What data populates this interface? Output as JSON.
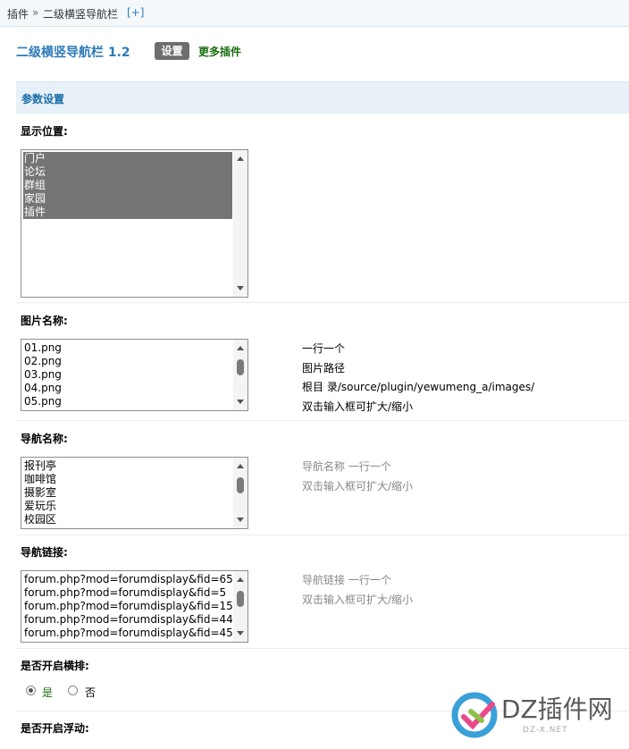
{
  "breadcrumb": {
    "root": "插件",
    "sep": "»",
    "current": "二级横竖导航栏",
    "add": "[+]"
  },
  "header": {
    "title": "二级横竖导航栏 1.2",
    "tab_settings": "设置",
    "tab_more": "更多插件"
  },
  "section_title": "参数设置",
  "display_position": {
    "label": "显示位置:",
    "options": [
      "门户",
      "论坛",
      "群组",
      "家园",
      "插件"
    ]
  },
  "image_names": {
    "label": "图片名称:",
    "lines": [
      "01.png",
      "02.png",
      "03.png",
      "04.png",
      "05.png"
    ],
    "hints": [
      "一行一个",
      "图片路径",
      "根目 录/source/plugin/yewumeng_a/images/",
      "双击输入框可扩大/缩小"
    ]
  },
  "nav_names": {
    "label": "导航名称:",
    "lines": [
      "报刊亭",
      "咖啡馆",
      "摄影室",
      "爱玩乐",
      "校园区"
    ],
    "hints": [
      "导航名称 一行一个",
      "双击输入框可扩大/缩小"
    ]
  },
  "nav_links": {
    "label": "导航链接:",
    "lines": [
      "forum.php?mod=forumdisplay&fid=65",
      "forum.php?mod=forumdisplay&fid=5",
      "forum.php?mod=forumdisplay&fid=15",
      "forum.php?mod=forumdisplay&fid=44",
      "forum.php?mod=forumdisplay&fid=45"
    ],
    "hints": [
      "导航链接 一行一个",
      "双击输入框可扩大/缩小"
    ]
  },
  "horizontal": {
    "label": "是否开启横排:",
    "yes": "是",
    "no": "否",
    "selected": "yes"
  },
  "floating": {
    "label": "是否开启浮动:"
  },
  "watermark": {
    "text": "DZ插件网",
    "sub": "DZ-X.NET"
  },
  "colors": {
    "accent": "#2b7ab8",
    "link_green": "#1a6e10",
    "selected_bg": "#757575",
    "section_bg": "#e8f1f8"
  }
}
